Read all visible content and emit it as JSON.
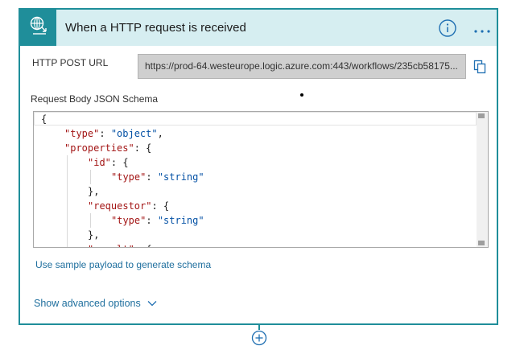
{
  "trigger": {
    "title": "When a HTTP request is received",
    "icon": "globe-request-icon",
    "accent_color": "#1f8e9a",
    "header_bg": "#d6eef1"
  },
  "http_post_url": {
    "label": "HTTP POST URL",
    "value": "https://prod-64.westeurope.logic.azure.com:443/workflows/235cb58175..."
  },
  "schema": {
    "label": "Request Body JSON Schema",
    "lines": [
      {
        "indent": 0,
        "tokens": [
          {
            "t": "p",
            "v": "{"
          }
        ]
      },
      {
        "indent": 1,
        "tokens": [
          {
            "t": "k",
            "v": "\"type\""
          },
          {
            "t": "p",
            "v": ": "
          },
          {
            "t": "s",
            "v": "\"object\""
          },
          {
            "t": "p",
            "v": ","
          }
        ]
      },
      {
        "indent": 1,
        "tokens": [
          {
            "t": "k",
            "v": "\"properties\""
          },
          {
            "t": "p",
            "v": ": {"
          }
        ]
      },
      {
        "indent": 2,
        "tokens": [
          {
            "t": "k",
            "v": "\"id\""
          },
          {
            "t": "p",
            "v": ": {"
          }
        ]
      },
      {
        "indent": 3,
        "tokens": [
          {
            "t": "k",
            "v": "\"type\""
          },
          {
            "t": "p",
            "v": ": "
          },
          {
            "t": "s",
            "v": "\"string\""
          }
        ]
      },
      {
        "indent": 2,
        "tokens": [
          {
            "t": "p",
            "v": "},"
          }
        ]
      },
      {
        "indent": 2,
        "tokens": [
          {
            "t": "k",
            "v": "\"requestor\""
          },
          {
            "t": "p",
            "v": ": {"
          }
        ]
      },
      {
        "indent": 3,
        "tokens": [
          {
            "t": "k",
            "v": "\"type\""
          },
          {
            "t": "p",
            "v": ": "
          },
          {
            "t": "s",
            "v": "\"string\""
          }
        ]
      },
      {
        "indent": 2,
        "tokens": [
          {
            "t": "p",
            "v": "},"
          }
        ]
      },
      {
        "indent": 2,
        "tokens": [
          {
            "t": "k",
            "v": "\"result\""
          },
          {
            "t": "p",
            "v": ": {"
          }
        ]
      }
    ]
  },
  "actions": {
    "sample_payload_link": "Use sample payload to generate schema",
    "advanced_options": "Show advanced options"
  }
}
